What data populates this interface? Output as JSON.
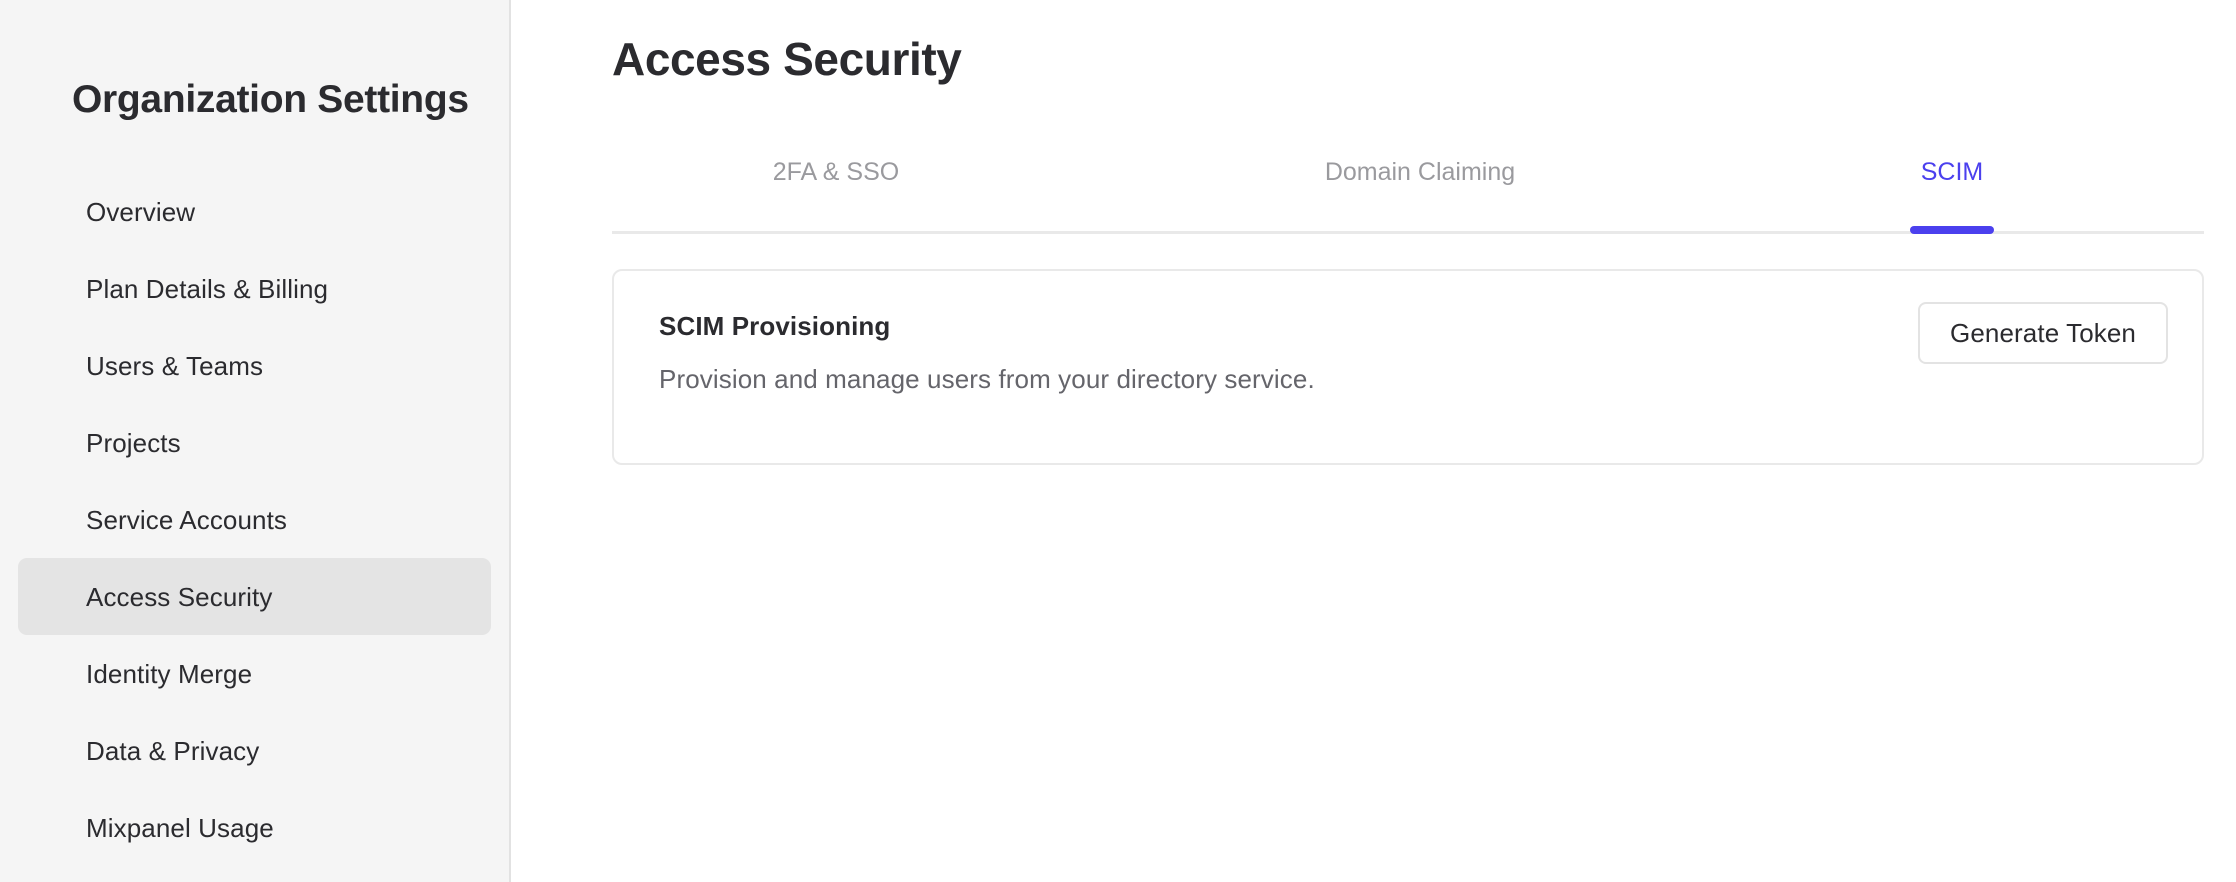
{
  "sidebar": {
    "title": "Organization Settings",
    "items": [
      {
        "label": "Overview",
        "selected": false
      },
      {
        "label": "Plan Details & Billing",
        "selected": false
      },
      {
        "label": "Users & Teams",
        "selected": false
      },
      {
        "label": "Projects",
        "selected": false
      },
      {
        "label": "Service Accounts",
        "selected": false
      },
      {
        "label": "Access Security",
        "selected": true
      },
      {
        "label": "Identity Merge",
        "selected": false
      },
      {
        "label": "Data & Privacy",
        "selected": false
      },
      {
        "label": "Mixpanel Usage",
        "selected": false
      }
    ]
  },
  "main": {
    "page_title": "Access Security",
    "tabs": [
      {
        "label": "2FA & SSO",
        "active": false
      },
      {
        "label": "Domain Claiming",
        "active": false
      },
      {
        "label": "SCIM",
        "active": true
      }
    ],
    "card": {
      "heading": "SCIM Provisioning",
      "description": "Provision and manage users from your directory service.",
      "action_label": "Generate Token"
    }
  },
  "colors": {
    "accent": "#4b40ee",
    "sidebar_bg": "#f5f5f5",
    "sidebar_selected_bg": "#e4e4e4",
    "text_primary": "#2b2b2f",
    "text_muted": "#9a9a9e",
    "description_text": "#65656b",
    "card_border": "#e9e9e9",
    "highlight_box": "#f61e00"
  }
}
